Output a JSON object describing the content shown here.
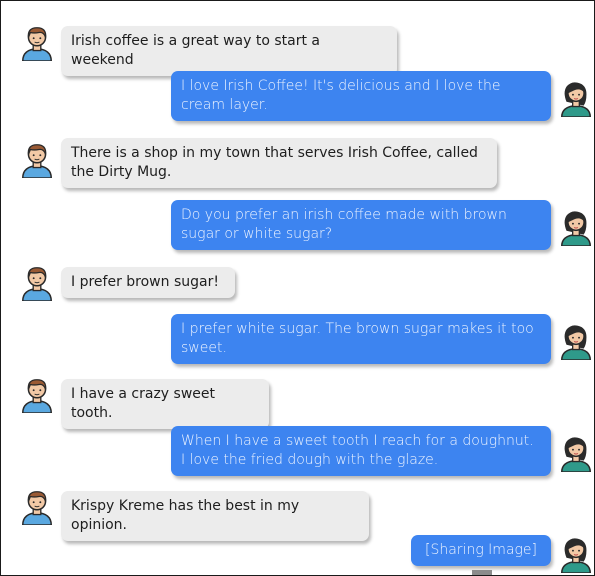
{
  "messages": [
    {
      "side": "left",
      "text": "Irish coffee is a great way to start a weekend"
    },
    {
      "side": "right",
      "text": "I love Irish Coffee! It's delicious and I love the cream layer."
    },
    {
      "side": "left",
      "text": "There is a shop in my town that serves Irish Coffee, called the Dirty Mug."
    },
    {
      "side": "right",
      "text": "Do you prefer an irish coffee made with brown sugar or white sugar?"
    },
    {
      "side": "left",
      "text": "I prefer brown sugar!"
    },
    {
      "side": "right",
      "text": "I prefer white sugar. The brown sugar makes it too sweet."
    },
    {
      "side": "left",
      "text": "I have a crazy sweet tooth."
    },
    {
      "side": "right",
      "text": "When I have a sweet tooth I reach for a doughnut. I love the fried dough with the glaze."
    },
    {
      "side": "left",
      "text": "Krispy Kreme has the best in my opinion."
    },
    {
      "side": "right",
      "text": "[Sharing Image]"
    }
  ],
  "colors": {
    "user_bubble": "#3d84f0",
    "partner_bubble": "#ececec",
    "male_shirt": "#5aa8e0",
    "female_shirt": "#2f9a8a"
  },
  "icons": {
    "left_avatar": "male-avatar-icon",
    "right_avatar": "female-avatar-icon"
  }
}
